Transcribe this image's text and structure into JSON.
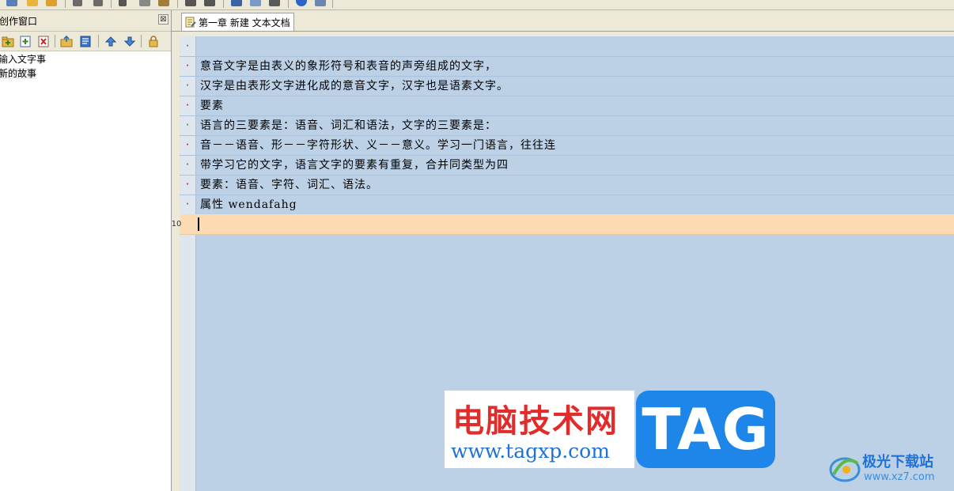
{
  "colors": {
    "editor_bg": "#bcd0e6",
    "current_line": "#fddcb4",
    "marker_red": "#cc2b2b",
    "marker_green": "#2d9a3e",
    "watermark_red": "#e22c2c",
    "watermark_blue": "#1e86e8"
  },
  "left_panel": {
    "title": "创作窗口",
    "close_glyph": "⊠",
    "tree": [
      {
        "label": "输入文字事"
      },
      {
        "label": "新的故事"
      }
    ]
  },
  "document_tab": {
    "label": "第一章 新建 文本文档",
    "icon": "document-edit-icon"
  },
  "editor": {
    "lines": [
      {
        "marker": "·",
        "text": ""
      },
      {
        "marker": "·",
        "text": "意音文字是由表义的象形符号和表音的声旁组成的文字，"
      },
      {
        "marker": "·",
        "text": "汉字是由表形文字进化成的意音文字，汉字也是语素文字。"
      },
      {
        "marker": "·",
        "text": "要素"
      },
      {
        "marker": "·",
        "text": "语言的三要素是：语音、词汇和语法，文字的三要素是："
      },
      {
        "marker": "·",
        "text": "音－－语音、形－－字符形状、义－－意义。学习一门语言，往往连"
      },
      {
        "marker": "·",
        "text": "带学习它的文字，语言文字的要素有重复，合并同类型为四"
      },
      {
        "marker": "·",
        "text": "要素：语音、字符、词汇、语法。"
      },
      {
        "marker": "·",
        "text": "属性  wendafahg"
      },
      {
        "marker": "10",
        "text": ""
      }
    ]
  },
  "watermark": {
    "title": "电脑技术网",
    "url": "www.tagxp.com",
    "tag": "TAG",
    "brand_name": "极光下载站",
    "brand_url": "www.xz7.com"
  }
}
